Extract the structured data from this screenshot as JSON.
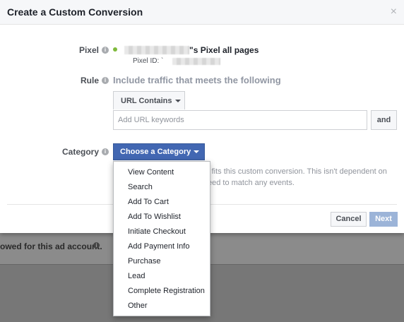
{
  "modal": {
    "title": "Create a Custom Conversion",
    "close_glyph": "×"
  },
  "pixel": {
    "label": "Pixel",
    "name_suffix": "\"s Pixel all pages",
    "id_label": "Pixel ID: `",
    "status_color": "#7fba3c"
  },
  "rule": {
    "label": "Rule",
    "description": "Include traffic that meets the following",
    "condition": "URL Contains",
    "input_placeholder": "Add URL keywords",
    "and_label": "and"
  },
  "category": {
    "label": "Category",
    "button_label": "Choose a Category",
    "hint_line1": "st fits this custom conversion. This isn't dependent on",
    "hint_line2": "eed to match any events.",
    "options": [
      "View Content",
      "Search",
      "Add To Cart",
      "Add To Wishlist",
      "Initiate Checkout",
      "Add Payment Info",
      "Purchase",
      "Lead",
      "Complete Registration",
      "Other"
    ]
  },
  "footer": {
    "cancel_label": "Cancel",
    "next_label": "Next"
  },
  "background": {
    "text": "owed for this ad account."
  },
  "colors": {
    "primary_button": "#4267b2",
    "disabled_button": "#9cb4d8"
  }
}
